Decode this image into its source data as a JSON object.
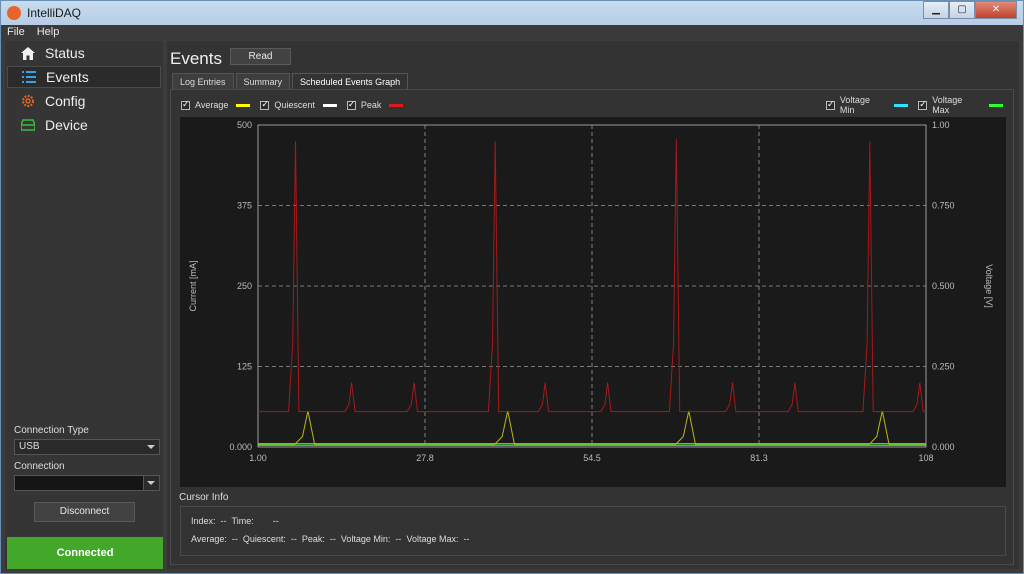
{
  "app": {
    "title": "IntelliDAQ"
  },
  "window_buttons": {
    "minimize": "▁",
    "maximize": "▢",
    "close": "✕"
  },
  "menu": [
    "File",
    "Help"
  ],
  "sidebar": {
    "items": [
      {
        "label": "Status",
        "icon": "home-icon",
        "active": false
      },
      {
        "label": "Events",
        "icon": "list-icon",
        "active": true
      },
      {
        "label": "Config",
        "icon": "gear-icon",
        "active": false
      },
      {
        "label": "Device",
        "icon": "device-icon",
        "active": false
      }
    ],
    "connection_type_label": "Connection Type",
    "connection_type_value": "USB",
    "connection_label": "Connection",
    "connection_value": "",
    "disconnect_label": "Disconnect",
    "status": "Connected"
  },
  "main": {
    "title": "Events",
    "read_label": "Read",
    "tabs": [
      {
        "label": "Log Entries",
        "active": false
      },
      {
        "label": "Summary",
        "active": false
      },
      {
        "label": "Scheduled Events Graph",
        "active": true
      }
    ]
  },
  "legend_left": [
    {
      "label": "Average",
      "color": "#ffff00",
      "checked": true
    },
    {
      "label": "Quiescent",
      "color": "#ffffff",
      "checked": true
    },
    {
      "label": "Peak",
      "color": "#ff2020",
      "checked": true
    }
  ],
  "legend_right": [
    {
      "label": "Voltage Min",
      "color": "#30e0ff",
      "checked": true
    },
    {
      "label": "Voltage Max",
      "color": "#30ff30",
      "checked": true
    }
  ],
  "cursor_info": {
    "title": "Cursor Info",
    "index_label": "Index:",
    "index_value": "--",
    "time_label": "Time:",
    "time_value": "--",
    "average_label": "Average:",
    "average_value": "--",
    "quiescent_label": "Quiescent:",
    "quiescent_value": "--",
    "peak_label": "Peak:",
    "peak_value": "--",
    "vmin_label": "Voltage Min:",
    "vmin_value": "--",
    "vmax_label": "Voltage Max:",
    "vmax_value": "--"
  },
  "chart_data": {
    "type": "line",
    "ylabel": "Current [mA]",
    "y2label": "Voltage [V]",
    "xlim": [
      1,
      108
    ],
    "ylim": [
      0,
      500
    ],
    "y2lim": [
      0,
      1
    ],
    "x_ticks": [
      "1.00",
      "27.8",
      "54.5",
      "81.3",
      "108"
    ],
    "y_ticks": [
      "0.000",
      "125",
      "250",
      "375",
      "500"
    ],
    "y2_ticks": [
      "0.000",
      "0.250",
      "0.500",
      "0.750",
      "1.00"
    ],
    "grid": true,
    "peak_baseline": 55,
    "peak_spikes": [
      {
        "x": 7,
        "y": 475
      },
      {
        "x": 16,
        "y": 100
      },
      {
        "x": 26,
        "y": 100
      },
      {
        "x": 39,
        "y": 475
      },
      {
        "x": 47,
        "y": 100
      },
      {
        "x": 57,
        "y": 100
      },
      {
        "x": 68,
        "y": 478
      },
      {
        "x": 77,
        "y": 100
      },
      {
        "x": 87,
        "y": 100
      },
      {
        "x": 99,
        "y": 475
      },
      {
        "x": 107,
        "y": 100
      }
    ],
    "average_baseline": 3,
    "average_spikes": [
      {
        "x": 9,
        "y": 56
      },
      {
        "x": 41,
        "y": 56
      },
      {
        "x": 70,
        "y": 56
      },
      {
        "x": 101,
        "y": 56
      }
    ],
    "voltage_max": 0.01,
    "voltage_min": 0.005
  }
}
